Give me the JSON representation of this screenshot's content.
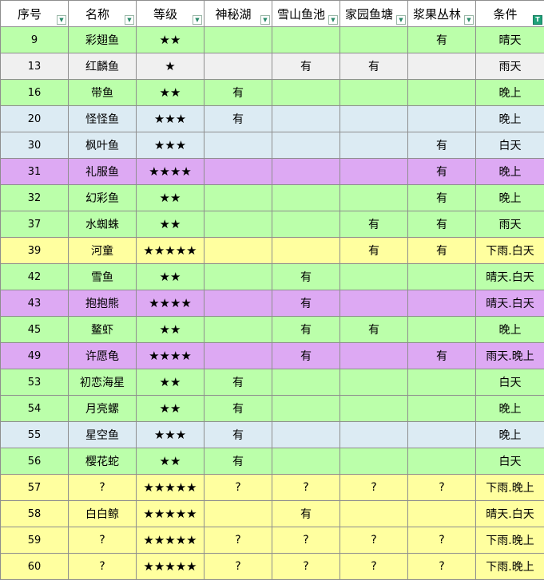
{
  "colors": {
    "green": "#bbffaa",
    "gray": "#f0f0f0",
    "blue": "#dcebf3",
    "purple": "#dda9f3",
    "yellow": "#ffff9f",
    "header_bg": "#ffffff",
    "grid": "#8e8e8e",
    "filter_active": "#1fa27a"
  },
  "header": {
    "columns": [
      {
        "label": "序号",
        "filter_icon": "dropdown-arrow-icon",
        "filter_glyph": "▼",
        "filter_active": false
      },
      {
        "label": "名称",
        "filter_icon": "dropdown-arrow-icon",
        "filter_glyph": "▼",
        "filter_active": false
      },
      {
        "label": "等级",
        "filter_icon": "dropdown-arrow-icon",
        "filter_glyph": "▼",
        "filter_active": false
      },
      {
        "label": "神秘湖",
        "filter_icon": "dropdown-arrow-icon",
        "filter_glyph": "▼",
        "filter_active": false
      },
      {
        "label": "雪山鱼池",
        "filter_icon": "dropdown-arrow-icon",
        "filter_glyph": "▼",
        "filter_active": false
      },
      {
        "label": "家园鱼塘",
        "filter_icon": "dropdown-arrow-icon",
        "filter_glyph": "▼",
        "filter_active": false
      },
      {
        "label": "浆果丛林",
        "filter_icon": "dropdown-arrow-icon",
        "filter_glyph": "▼",
        "filter_active": false
      },
      {
        "label": "条件",
        "filter_icon": "filter-applied-icon",
        "filter_glyph": "T",
        "filter_active": true
      }
    ]
  },
  "rows": [
    {
      "color": "green",
      "cells": [
        "9",
        "彩翅鱼",
        "★★",
        "",
        "",
        "",
        "有",
        "晴天"
      ]
    },
    {
      "color": "gray",
      "cells": [
        "13",
        "红麟鱼",
        "★",
        "",
        "有",
        "有",
        "",
        "雨天"
      ]
    },
    {
      "color": "green",
      "cells": [
        "16",
        "带鱼",
        "★★",
        "有",
        "",
        "",
        "",
        "晚上"
      ]
    },
    {
      "color": "blue",
      "cells": [
        "20",
        "怪怪鱼",
        "★★★",
        "有",
        "",
        "",
        "",
        "晚上"
      ]
    },
    {
      "color": "blue",
      "cells": [
        "30",
        "枫叶鱼",
        "★★★",
        "",
        "",
        "",
        "有",
        "白天"
      ]
    },
    {
      "color": "purple",
      "cells": [
        "31",
        "礼服鱼",
        "★★★★",
        "",
        "",
        "",
        "有",
        "晚上"
      ]
    },
    {
      "color": "green",
      "cells": [
        "32",
        "幻彩鱼",
        "★★",
        "",
        "",
        "",
        "有",
        "晚上"
      ]
    },
    {
      "color": "green",
      "cells": [
        "37",
        "水蜘蛛",
        "★★",
        "",
        "",
        "有",
        "有",
        "雨天"
      ]
    },
    {
      "color": "yellow",
      "cells": [
        "39",
        "河童",
        "★★★★★",
        "",
        "",
        "有",
        "有",
        "下雨.白天"
      ]
    },
    {
      "color": "green",
      "cells": [
        "42",
        "雪鱼",
        "★★",
        "",
        "有",
        "",
        "",
        "晴天.白天"
      ]
    },
    {
      "color": "purple",
      "cells": [
        "43",
        "抱抱熊",
        "★★★★",
        "",
        "有",
        "",
        "",
        "晴天.白天"
      ]
    },
    {
      "color": "green",
      "cells": [
        "45",
        "鳌虾",
        "★★",
        "",
        "有",
        "有",
        "",
        "晚上"
      ]
    },
    {
      "color": "purple",
      "cells": [
        "49",
        "许愿龟",
        "★★★★",
        "",
        "有",
        "",
        "有",
        "雨天.晚上"
      ]
    },
    {
      "color": "green",
      "cells": [
        "53",
        "初恋海星",
        "★★",
        "有",
        "",
        "",
        "",
        "白天"
      ]
    },
    {
      "color": "green",
      "cells": [
        "54",
        "月亮螺",
        "★★",
        "有",
        "",
        "",
        "",
        "晚上"
      ]
    },
    {
      "color": "blue",
      "cells": [
        "55",
        "星空鱼",
        "★★★",
        "有",
        "",
        "",
        "",
        "晚上"
      ]
    },
    {
      "color": "green",
      "cells": [
        "56",
        "樱花蛇",
        "★★",
        "有",
        "",
        "",
        "",
        "白天"
      ]
    },
    {
      "color": "yellow",
      "cells": [
        "57",
        "?",
        "★★★★★",
        "?",
        "?",
        "?",
        "?",
        "下雨.晚上"
      ]
    },
    {
      "color": "yellow",
      "cells": [
        "58",
        "白白鲸",
        "★★★★★",
        "",
        "有",
        "",
        "",
        "晴天.白天"
      ]
    },
    {
      "color": "yellow",
      "cells": [
        "59",
        "?",
        "★★★★★",
        "?",
        "?",
        "?",
        "?",
        "下雨.晚上"
      ]
    },
    {
      "color": "yellow",
      "cells": [
        "60",
        "?",
        "★★★★★",
        "?",
        "?",
        "?",
        "?",
        "下雨.晚上"
      ]
    }
  ]
}
